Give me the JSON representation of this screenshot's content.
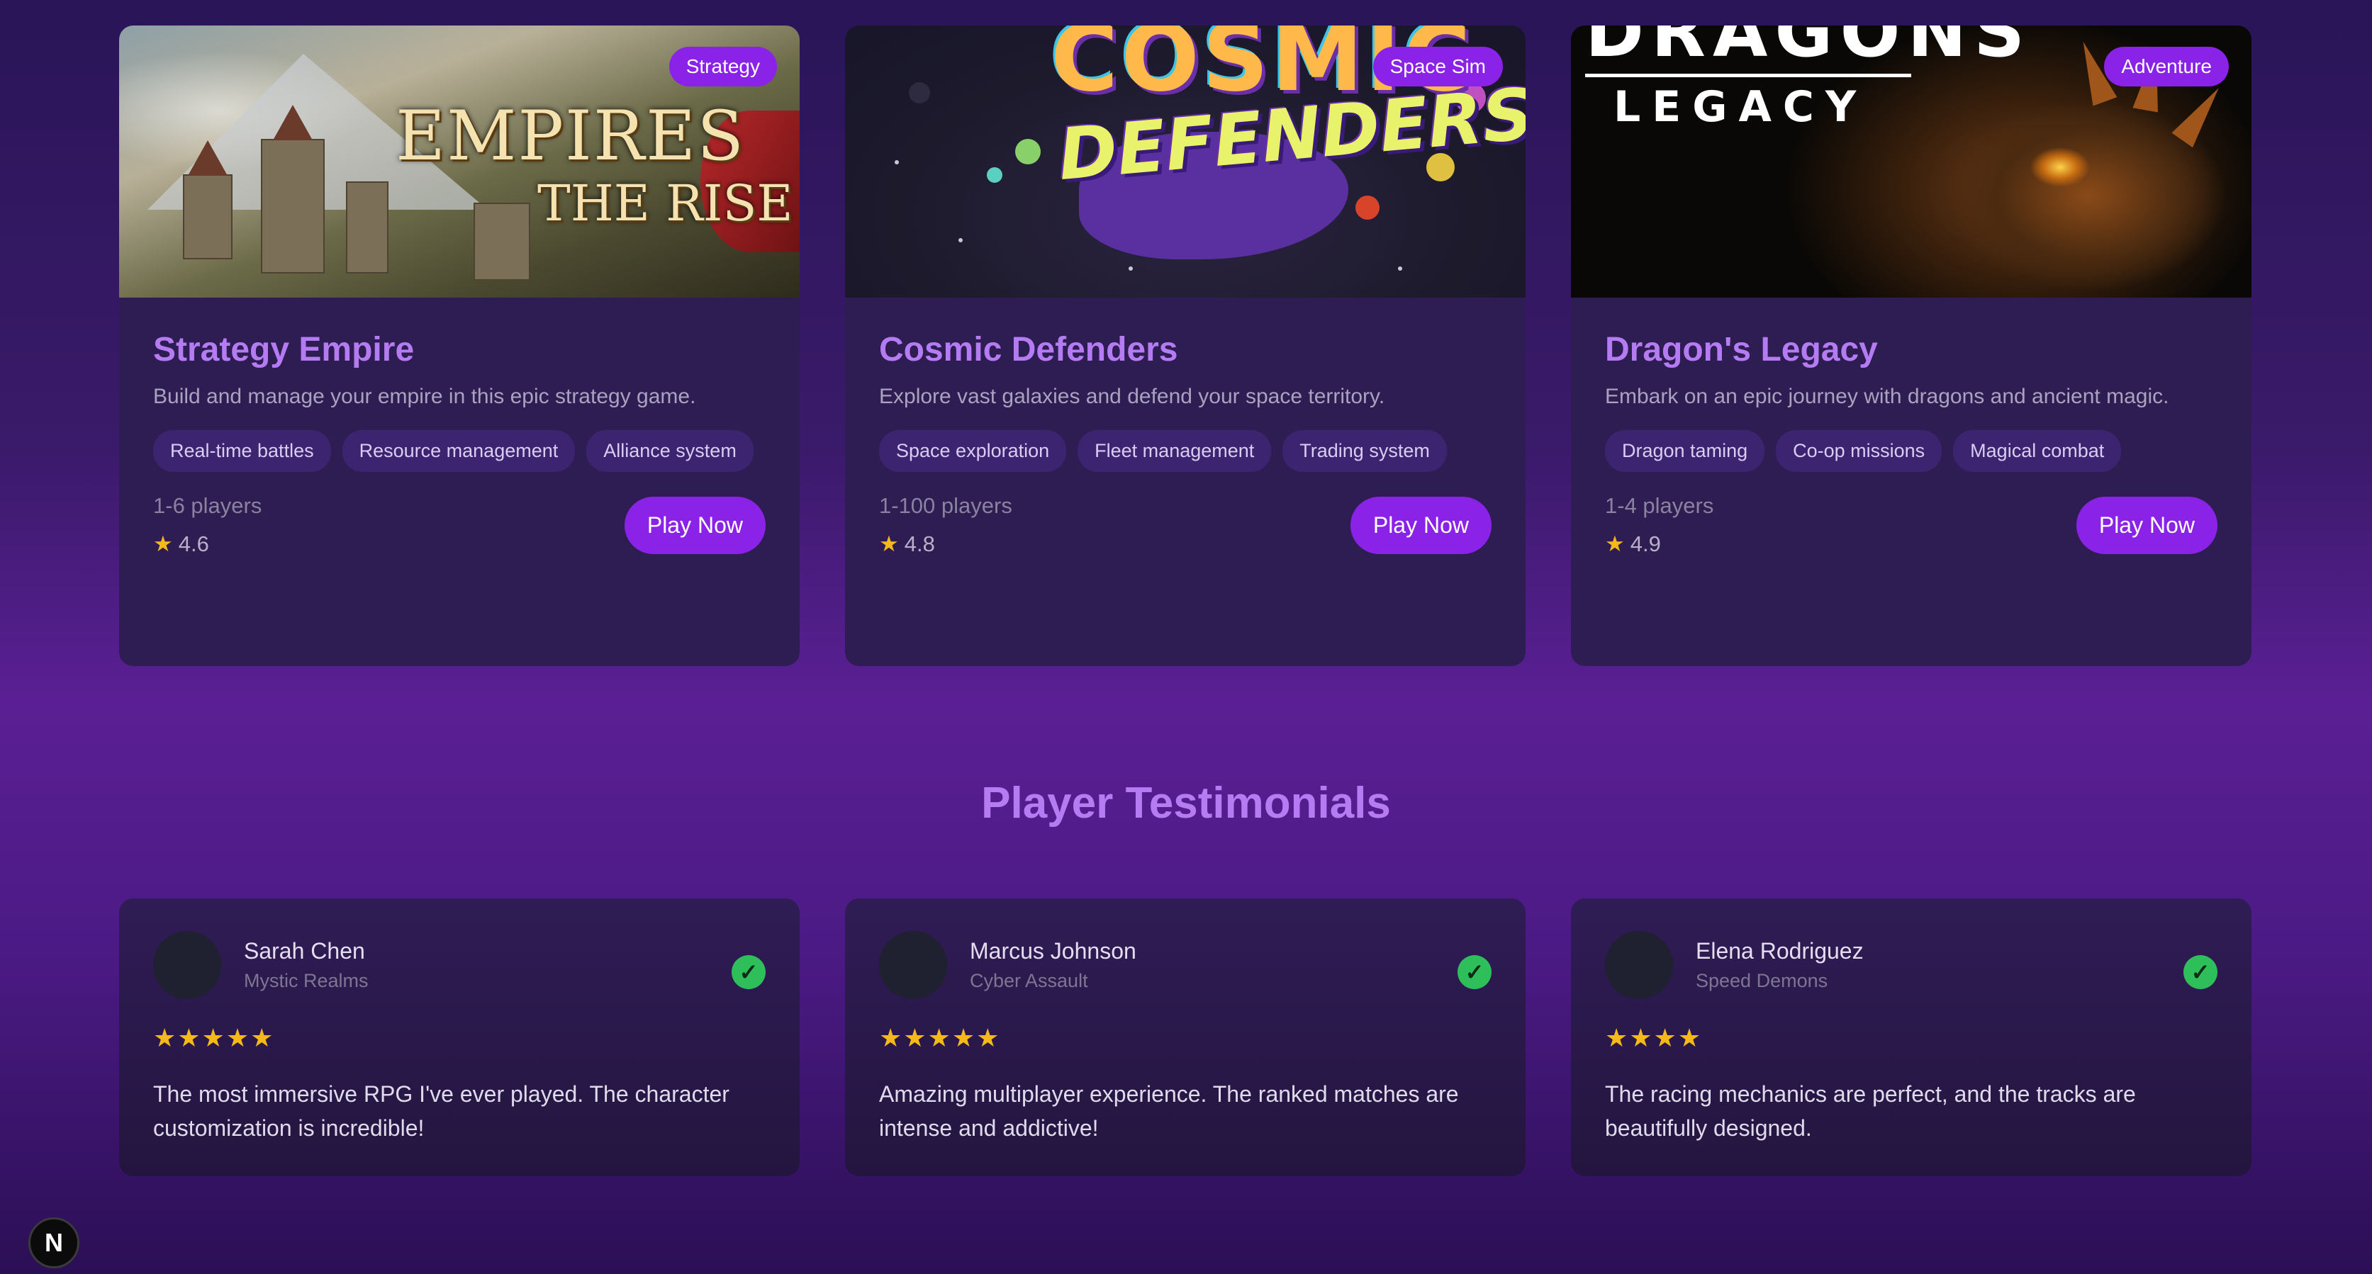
{
  "games": [
    {
      "title": "Strategy Empire",
      "badge": "Strategy",
      "image_title_line1": "EMPIRES",
      "image_title_line2": "THE RISE",
      "description": "Build and manage your empire in this epic strategy game.",
      "tags": [
        "Real-time battles",
        "Resource management",
        "Alliance system"
      ],
      "players": "1-6 players",
      "rating": "4.6",
      "cta": "Play Now"
    },
    {
      "title": "Cosmic Defenders",
      "badge": "Space Sim",
      "image_title_line1": "COSMIC",
      "image_title_line2": "DEFENDERS",
      "description": "Explore vast galaxies and defend your space territory.",
      "tags": [
        "Space exploration",
        "Fleet management",
        "Trading system"
      ],
      "players": "1-100 players",
      "rating": "4.8",
      "cta": "Play Now"
    },
    {
      "title": "Dragon's Legacy",
      "badge": "Adventure",
      "image_title_line1": "DRAGONS",
      "image_title_line2": "LEGACY",
      "description": "Embark on an epic journey with dragons and ancient magic.",
      "tags": [
        "Dragon taming",
        "Co-op missions",
        "Magical combat"
      ],
      "players": "1-4 players",
      "rating": "4.9",
      "cta": "Play Now"
    }
  ],
  "testimonials_section": {
    "title": "Player Testimonials",
    "items": [
      {
        "name": "Sarah Chen",
        "game": "Mystic Realms",
        "stars": "★★★★★",
        "text": "The most immersive RPG I've ever played. The character customization is incredible!"
      },
      {
        "name": "Marcus Johnson",
        "game": "Cyber Assault",
        "stars": "★★★★★",
        "text": "Amazing multiplayer experience. The ranked matches are intense and addictive!"
      },
      {
        "name": "Elena Rodriguez",
        "game": "Speed Demons",
        "stars": "★★★★",
        "text": "The racing mechanics are perfect, and the tracks are beautifully designed."
      }
    ]
  },
  "dev_indicator": "N",
  "colors": {
    "accent": "#8a22e8",
    "title": "#b57bf2",
    "star": "#f5b91a",
    "verified": "#2fbf5a"
  },
  "icons": {
    "rating": "star-icon",
    "verified": "check-circle-icon"
  }
}
